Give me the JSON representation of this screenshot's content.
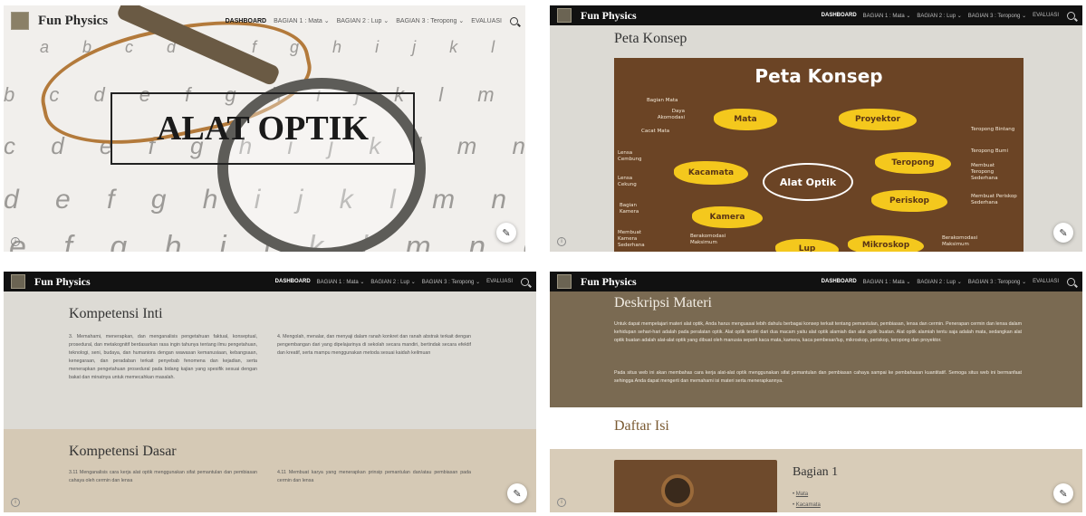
{
  "nav": {
    "brand": "Fun Physics",
    "items": [
      "DASHBOARD",
      "BAGIAN 1 : Mata",
      "BAGIAN 2 : Lup",
      "BAGIAN 3 : Teropong",
      "EVALUASI"
    ]
  },
  "hero": {
    "title": "ALAT OPTIK",
    "letter_rows": [
      "a b c d e f g h i j k l m n o p q r",
      "b c d e f g h i j k l m n o p q r s t u",
      "c d e f g h i j k l m n o p q r s t u v",
      "d e f g h i j k l m n o p q r s t u v",
      "e f g h i j k l m n o p q r s"
    ]
  },
  "peta": {
    "heading": "Peta Konsep",
    "map_title": "Peta Konsep",
    "center": "Alat Optik",
    "nodes": [
      "Mata",
      "Proyektor",
      "Kacamata",
      "Teropong",
      "Kamera",
      "Periskop",
      "Lup",
      "Mikroskop"
    ],
    "notes": [
      "Bagian Mata",
      "Daya Akomodasi",
      "Cacat Mata",
      "Lensa Cembung",
      "Lensa Cekung",
      "Bagian Kamera",
      "Membuat Kamera Sederhana",
      "Berakomodasi Maksimum",
      "Teropong Bintang",
      "Teropong Bumi",
      "Membuat Teropong Sederhana",
      "Membuat Periskop Sederhana",
      "Berakomodasi Maksimum"
    ]
  },
  "kompetensi": {
    "ki_title": "Kompetensi Inti",
    "ki_left": "3. Memahami, menerapkan, dan menganalisis pengetahuan faktual, konseptual, prosedural, dan metakognitif berdasarkan rasa ingin tahunya tentang ilmu pengetahuan, teknologi, seni, budaya, dan humaniora dengan wawasan kemanusiaan, kebangsaan, kenegaraan, dan peradaban terkait penyebab fenomena dan kejadian, serta menerapkan pengetahuan prosedural pada bidang kajian yang spesifik sesuai dengan bakat dan minatnya untuk memecahkan masalah.",
    "ki_right": "4. Mengolah, menalar, dan menyaji dalam ranah konkret dan ranah abstrak terkait dengan pengembangan dari yang dipelajarinya di sekolah secara mandiri, bertindak secara efektif dan kreatif, serta mampu menggunakan metoda sesuai kaidah keilmuan",
    "kd_title": "Kompetensi Dasar",
    "kd_left": "3.11 Menganalisis cara kerja alat optik menggunakan sifat pemantulan dan pembiasan cahaya oleh cermin dan lensa",
    "kd_right": "4.11 Membuat karya yang menerapkan prinsip pemantulan dan/atau pembiasan pada cermin dan lensa"
  },
  "deskripsi": {
    "title": "Deskripsi Materi",
    "p1": "Untuk dapat mempelajari materi alat optik, Anda harus menguasai lebih dahulu berbagai konsep terkait tentang pemantulan, pembiasan, lensa dan cermin. Penerapan cermin dan lensa dalam kehidupan sehari-hari adalah pada peralatan optik. Alat optik terdiri dari dua macam yaitu alat optik alamiah dan alat optik buatan. Alat optik alamiah tentu saja adalah mata, sedangkan alat optik buatan adalah alat-alat optik yang dibuat oleh manusia seperti kaca mata, kamera, kaca pembesar/lup, mikroskop, periskop, teropong dan proyektor.",
    "p2": "Pada situs web ini akan membahas cara kerja alat-alat optik menggunakan sifat pemantulan dan pembiasan cahaya sampai ke pembahasan kuantitatif. Semoga situs web ini bermanfaat sehingga Anda dapat mengerti dan memahami isi materi serta menerapkannya."
  },
  "daftar": {
    "title": "Daftar Isi",
    "bagian_title": "Bagian 1",
    "items": [
      "Mata",
      "Kacamata"
    ]
  },
  "colors": {
    "nav": "#111111",
    "desk_bg": "#7a6a52",
    "concept_bg": "#6b4425",
    "blob": "#f4c81d"
  },
  "icons": [
    "search-icon",
    "edit-pencil-icon",
    "info-icon",
    "chevron-down-icon"
  ]
}
